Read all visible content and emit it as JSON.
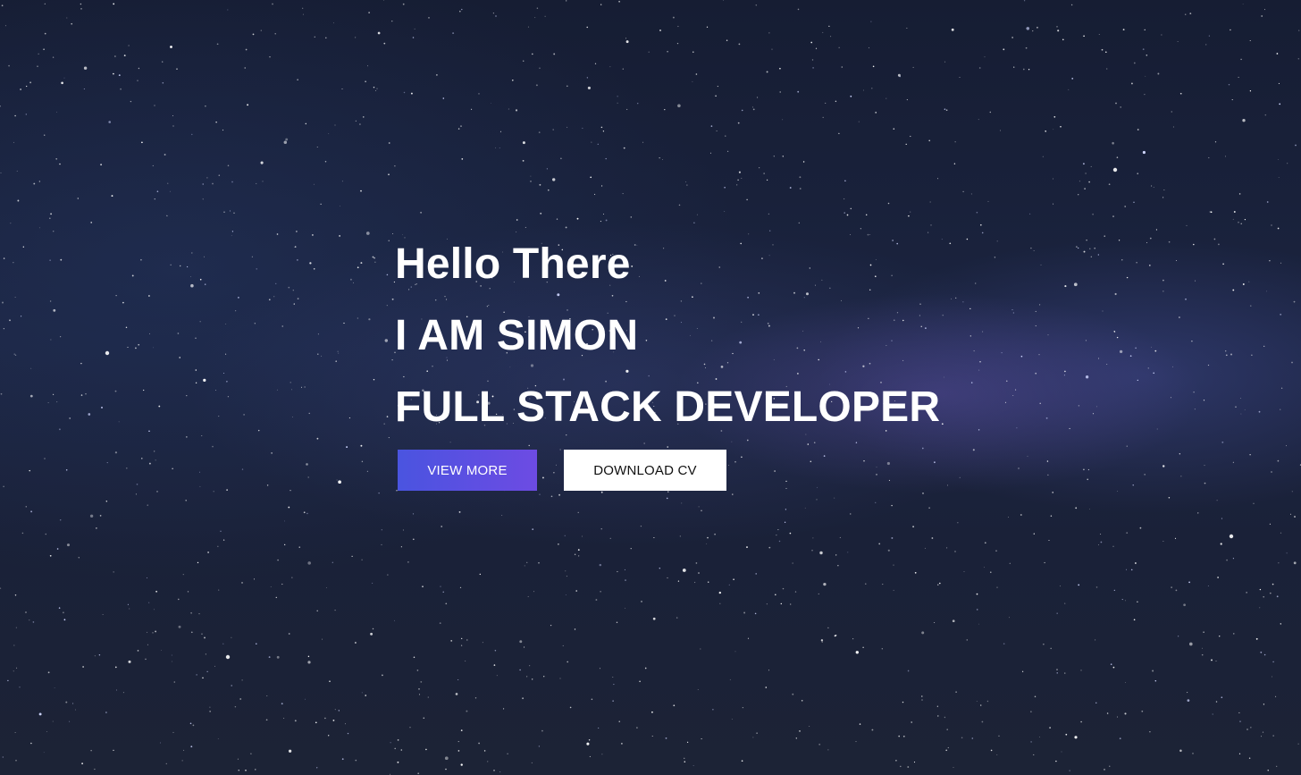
{
  "hero": {
    "greeting": "Hello There",
    "name_line": "I AM SIMON",
    "role_line": "FULL STACK DEVELOPER"
  },
  "actions": {
    "view_more_label": "VIEW MORE",
    "download_cv_label": "DOWNLOAD CV"
  },
  "colors": {
    "background": "#1b2440",
    "primary_gradient_start": "#4a54e0",
    "primary_gradient_end": "#6d4be3",
    "secondary_button": "#ffffff",
    "heading_text": "#ffffff"
  }
}
